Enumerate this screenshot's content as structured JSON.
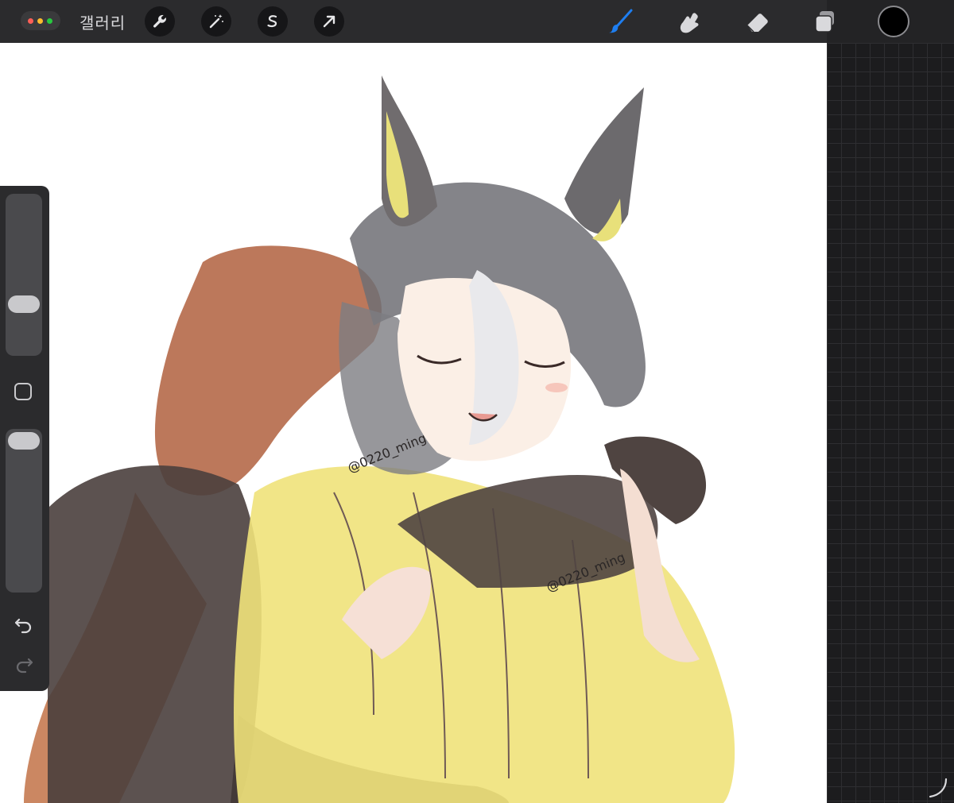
{
  "topbar": {
    "gallery_label": "갤러리"
  },
  "tools": {
    "left": [
      "wrench-icon",
      "magic-wand-icon",
      "selection-icon",
      "transform-arrow-icon"
    ],
    "right": [
      "brush-icon",
      "smudge-icon",
      "eraser-icon",
      "layers-icon"
    ],
    "active": "brush-icon",
    "active_color": "#1e7ef0",
    "current_color": "#000000"
  },
  "canvas": {
    "watermark_1": "@0220_ming",
    "watermark_2": "@0220_ming"
  }
}
